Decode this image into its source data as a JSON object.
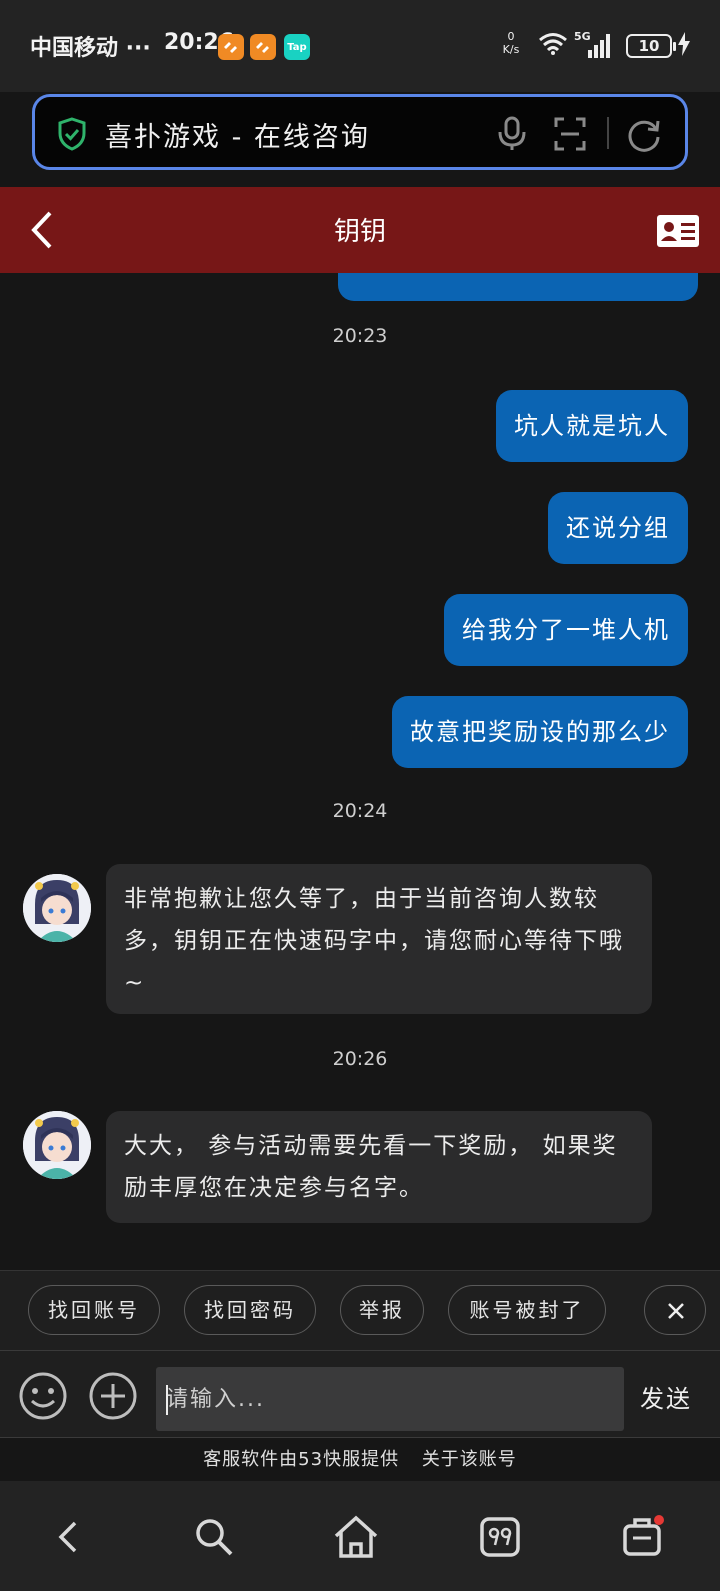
{
  "status_bar": {
    "carrier": "中国移动 ···",
    "time": "20:26",
    "app_icons": [
      {
        "name": "app-icon-1",
        "color": "#f08a24",
        "label": ""
      },
      {
        "name": "app-icon-2",
        "color": "#f08a24",
        "label": ""
      },
      {
        "name": "taptap-icon",
        "color": "#19d2c2",
        "label": "Tap"
      }
    ],
    "net_speed_value": "0",
    "net_speed_unit": "K/s",
    "network": "5G",
    "battery": "10"
  },
  "browser": {
    "page_title": "喜扑游戏 - 在线咨询"
  },
  "chat": {
    "agent_name": "钥钥"
  },
  "messages": {
    "time_1": "20:23",
    "out_1": "坑人就是坑人",
    "out_2": "还说分组",
    "out_3": "给我分了一堆人机",
    "out_4": "故意把奖励设的那么少",
    "time_2": "20:24",
    "in_1": "非常抱歉让您久等了，由于当前咨询人数较多，钥钥正在快速码字中，请您耐心等待下哦~",
    "time_3": "20:26",
    "in_2": "大大， 参与活动需要先看一下奖励， 如果奖励丰厚您在决定参与名字。"
  },
  "quick_replies": [
    "找回账号",
    "找回密码",
    "举报",
    "账号被封了"
  ],
  "input": {
    "placeholder": "请输入...",
    "send_label": "发送"
  },
  "footer": {
    "provider": "客服软件由53快服提供",
    "about": "关于该账号"
  },
  "colors": {
    "header": "#771717",
    "bubble_out": "#0b64b3",
    "bubble_in": "#2b2b2c",
    "url_border": "#5a86e8"
  }
}
